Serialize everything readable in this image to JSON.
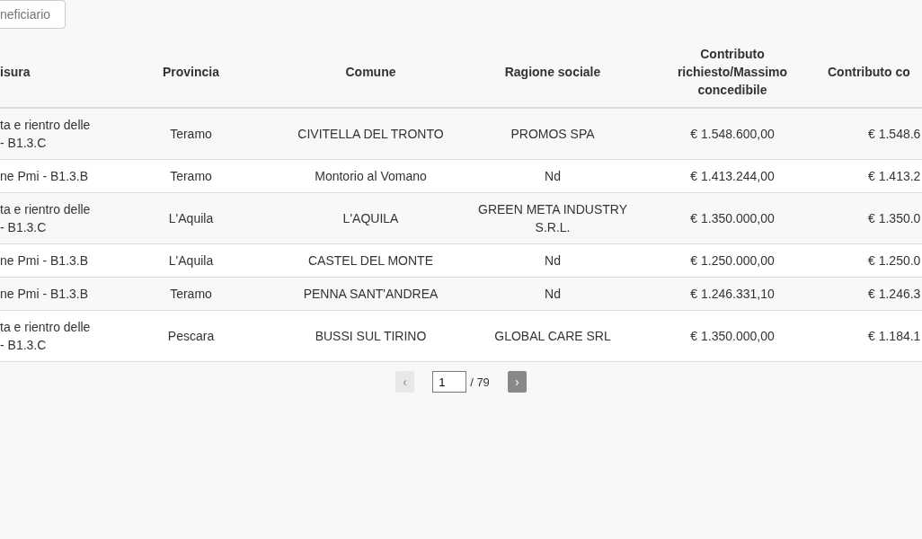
{
  "search": {
    "placeholder": "neficiario"
  },
  "table": {
    "columns": [
      "isura",
      "Provincia",
      "Comune",
      "Ragione sociale",
      "Contributo richiesto/Massimo concedibile",
      "Contributo co"
    ],
    "rows": [
      {
        "cells": [
          "ta e rientro delle\n- B1.3.C",
          "Teramo",
          "CIVITELLA DEL TRONTO",
          "PROMOS SPA",
          "€ 1.548.600,00",
          "€ 1.548.6"
        ]
      },
      {
        "cells": [
          "ne Pmi - B1.3.B",
          "Teramo",
          "Montorio al Vomano",
          "Nd",
          "€ 1.413.244,00",
          "€ 1.413.2"
        ]
      },
      {
        "cells": [
          "ta e rientro delle\n- B1.3.C",
          "L'Aquila",
          "L'AQUILA",
          "GREEN META INDUSTRY S.R.L.",
          "€ 1.350.000,00",
          "€ 1.350.0"
        ]
      },
      {
        "cells": [
          "ne Pmi - B1.3.B",
          "L'Aquila",
          "CASTEL DEL MONTE",
          "Nd",
          "€ 1.250.000,00",
          "€ 1.250.0"
        ]
      },
      {
        "cells": [
          "ne Pmi - B1.3.B",
          "Teramo",
          "PENNA SANT'ANDREA",
          "Nd",
          "€ 1.246.331,10",
          "€ 1.246.3"
        ]
      },
      {
        "cells": [
          "ta e rientro delle\n- B1.3.C",
          "Pescara",
          "BUSSI SUL TIRINO",
          "GLOBAL CARE SRL",
          "€ 1.350.000,00",
          "€ 1.184.1"
        ]
      }
    ]
  },
  "pagination": {
    "prev": {
      "label": "‹",
      "disabled": true
    },
    "page": "1",
    "total": "/ 79",
    "next": {
      "label": "›",
      "disabled": false
    }
  }
}
